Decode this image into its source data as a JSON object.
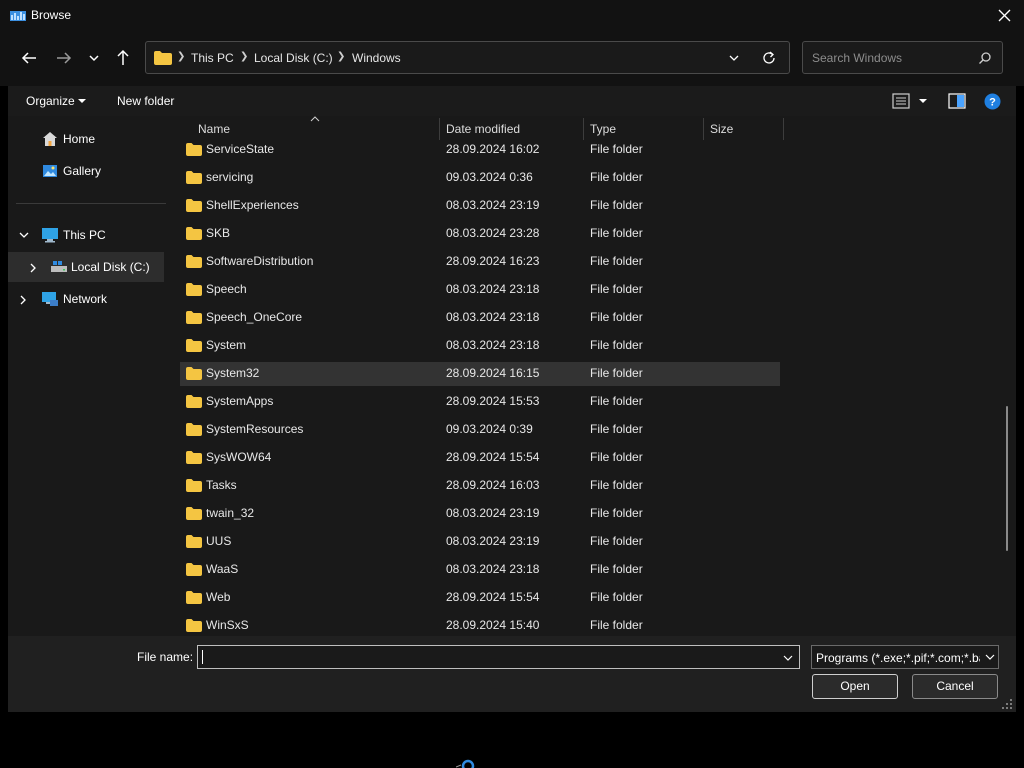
{
  "window": {
    "title": "Browse",
    "app_icon": "folder-browse-icon",
    "close_icon": "close-icon"
  },
  "nav": {
    "back_icon": "arrow-left-icon",
    "forward_icon": "arrow-right-icon",
    "recent_icon": "chevron-down-icon",
    "up_icon": "arrow-up-icon",
    "breadcrumbs": [
      "This PC",
      "Local Disk (C:)",
      "Windows"
    ],
    "refresh_icon": "refresh-icon",
    "search_placeholder": "Search Windows"
  },
  "toolbar": {
    "organize_label": "Organize",
    "new_folder_label": "New folder"
  },
  "sidebar": {
    "items": [
      {
        "label": "Home",
        "icon": "home-icon"
      },
      {
        "label": "Gallery",
        "icon": "gallery-icon"
      },
      {
        "label": "This PC",
        "icon": "computer-icon",
        "expanded": true
      },
      {
        "label": "Local Disk (C:)",
        "icon": "drive-icon",
        "selected": true
      },
      {
        "label": "Network",
        "icon": "network-icon"
      }
    ]
  },
  "columns": {
    "name": "Name",
    "date": "Date modified",
    "type": "Type",
    "size": "Size"
  },
  "files": [
    {
      "name": "ServiceState",
      "date": "28.09.2024 16:02",
      "type": "File folder"
    },
    {
      "name": "servicing",
      "date": "09.03.2024 0:36",
      "type": "File folder"
    },
    {
      "name": "ShellExperiences",
      "date": "08.03.2024 23:19",
      "type": "File folder"
    },
    {
      "name": "SKB",
      "date": "08.03.2024 23:28",
      "type": "File folder"
    },
    {
      "name": "SoftwareDistribution",
      "date": "28.09.2024 16:23",
      "type": "File folder"
    },
    {
      "name": "Speech",
      "date": "08.03.2024 23:18",
      "type": "File folder"
    },
    {
      "name": "Speech_OneCore",
      "date": "08.03.2024 23:18",
      "type": "File folder"
    },
    {
      "name": "System",
      "date": "08.03.2024 23:18",
      "type": "File folder"
    },
    {
      "name": "System32",
      "date": "28.09.2024 16:15",
      "type": "File folder",
      "selected": true
    },
    {
      "name": "SystemApps",
      "date": "28.09.2024 15:53",
      "type": "File folder"
    },
    {
      "name": "SystemResources",
      "date": "09.03.2024 0:39",
      "type": "File folder"
    },
    {
      "name": "SysWOW64",
      "date": "28.09.2024 15:54",
      "type": "File folder"
    },
    {
      "name": "Tasks",
      "date": "28.09.2024 16:03",
      "type": "File folder"
    },
    {
      "name": "twain_32",
      "date": "08.03.2024 23:19",
      "type": "File folder"
    },
    {
      "name": "UUS",
      "date": "08.03.2024 23:19",
      "type": "File folder"
    },
    {
      "name": "WaaS",
      "date": "08.03.2024 23:18",
      "type": "File folder"
    },
    {
      "name": "Web",
      "date": "28.09.2024 15:54",
      "type": "File folder"
    },
    {
      "name": "WinSxS",
      "date": "28.09.2024 15:40",
      "type": "File folder"
    }
  ],
  "bottom": {
    "file_name_label": "File name:",
    "file_name_value": "",
    "file_type": "Programs (*.exe;*.pif;*.com;*.bat;*.cmd)",
    "open_label": "Open",
    "cancel_label": "Cancel"
  },
  "colors": {
    "folder": "#f4c542",
    "accent": "#1e90ff",
    "help": "#1f7fe0"
  }
}
